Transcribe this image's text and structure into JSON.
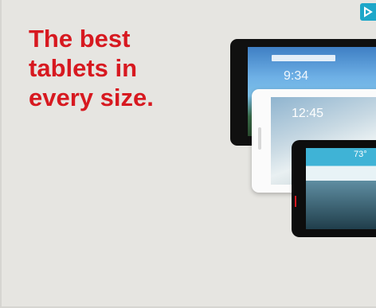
{
  "ad": {
    "headline_lines": [
      "The best",
      "tablets in",
      "every size."
    ],
    "colors": {
      "headline": "#d71920",
      "background": "#e6e5e1",
      "badge": "#1ea7c9"
    },
    "corner_badge_icon": "adchoices-icon",
    "tablets": {
      "large_clock": "9:34",
      "medium_clock": "12:45",
      "small_temp": "73°"
    }
  }
}
